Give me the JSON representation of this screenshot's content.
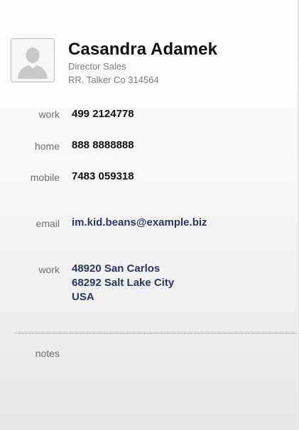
{
  "contact": {
    "name": "Casandra Adamek",
    "job_title": "Director Sales",
    "company": "RR. Talker Co 314564"
  },
  "phones": [
    {
      "label": "work",
      "value": "499 2124778"
    },
    {
      "label": "home",
      "value": "888 8888888"
    },
    {
      "label": "mobile",
      "value": "7483 059318"
    }
  ],
  "email": {
    "label": "email",
    "value": "im.kid.beans@example.biz"
  },
  "address": {
    "label": "work",
    "lines": [
      "48920 San Carlos",
      "68292 Salt Lake City",
      "USA"
    ]
  },
  "notes": {
    "label": "notes",
    "value": ""
  },
  "icons": {
    "avatar": "person-silhouette-icon"
  },
  "colors": {
    "link_text": "#2c3660",
    "phone_text": "#111111",
    "label_text": "#6e6e6e"
  }
}
